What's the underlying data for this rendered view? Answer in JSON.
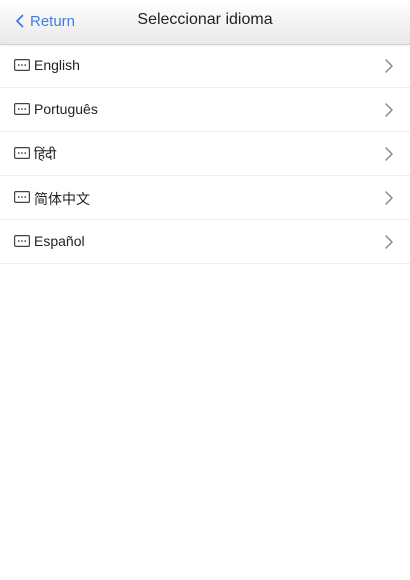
{
  "header": {
    "back_label": "Return",
    "title": "Seleccionar idioma"
  },
  "languages": [
    {
      "label": "English"
    },
    {
      "label": "Português"
    },
    {
      "label": "हिंदी"
    },
    {
      "label": "简体中文"
    },
    {
      "label": "Español"
    }
  ],
  "colors": {
    "accent": "#3a7ee6",
    "text": "#222222",
    "divider": "#efefef"
  },
  "icons": {
    "back": "chevron-left-icon",
    "language": "keyboard-icon",
    "row_arrow": "chevron-right-icon"
  }
}
